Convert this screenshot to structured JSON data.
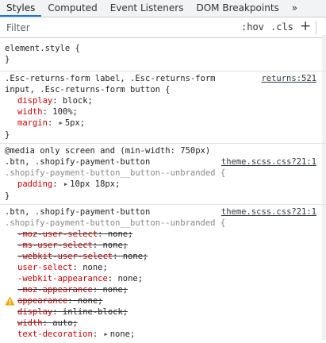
{
  "tabs": [
    "Styles",
    "Computed",
    "Event Listeners",
    "DOM Breakpoints"
  ],
  "more_tabs_icon": "»",
  "filter": {
    "placeholder": "Filter",
    "hov": ":hov",
    "cls": ".cls",
    "add": "+"
  },
  "rules": {
    "element_style": {
      "selector": "element.style {",
      "close": "}"
    },
    "rule1": {
      "selector_line1": ".Esc-returns-form label, .Esc-returns-form",
      "selector_line2": "input, .Esc-returns-form button {",
      "source": "returns:521",
      "decls": [
        {
          "name": "display",
          "value": "block;"
        },
        {
          "name": "width",
          "value": "100%;"
        },
        {
          "name": "margin",
          "value": "5px;"
        }
      ],
      "close": "}"
    },
    "rule2": {
      "media": "@media only screen and (min-width: 750px)",
      "selector_line1": ".btn, .shopify-payment-button",
      "selector_line2": ".shopify-payment-button__button--unbranded {",
      "source": "theme.scss.css?21:1",
      "decls": [
        {
          "name": "padding",
          "value": "10px 18px;"
        }
      ],
      "close": "}"
    },
    "rule3": {
      "selector_line1": ".btn, .shopify-payment-button",
      "selector_line2": ".shopify-payment-button__button--unbranded {",
      "source": "theme.scss.css?21:1",
      "decls": [
        {
          "name": "-moz-user-select",
          "value": "none;"
        },
        {
          "name": "-ms-user-select",
          "value": "none;"
        },
        {
          "name": "-webkit-user-select",
          "value": "none;"
        },
        {
          "name": "user-select",
          "value": "none;"
        },
        {
          "name": "-webkit-appearance",
          "value": "none;"
        },
        {
          "name": "-moz-appearance",
          "value": "none;"
        },
        {
          "name": "appearance",
          "value": "none;"
        },
        {
          "name": "display",
          "value": "inline-block;"
        },
        {
          "name": "width",
          "value": "auto;"
        },
        {
          "name": "text-decoration",
          "value": "none;"
        }
      ]
    }
  }
}
